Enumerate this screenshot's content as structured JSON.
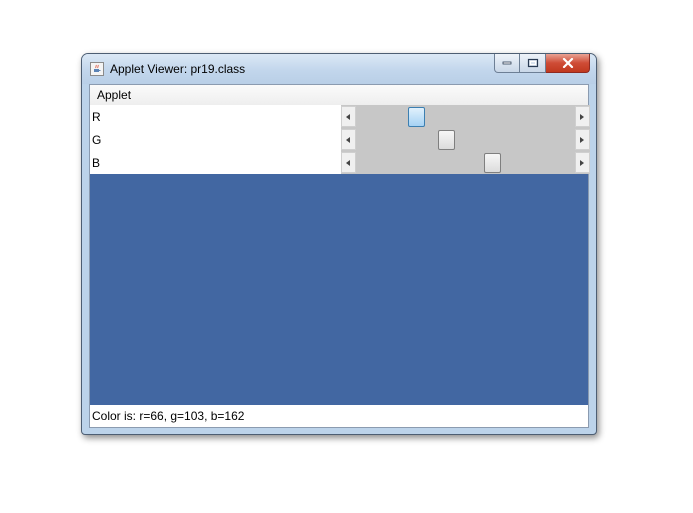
{
  "window": {
    "title": "Applet Viewer: pr19.class",
    "app_icon": "java-cup-icon",
    "controls": {
      "minimize": "minimize-icon",
      "maximize": "maximize-icon",
      "close": "close-icon"
    }
  },
  "menubar": {
    "items": [
      {
        "label": "Applet"
      }
    ]
  },
  "sliders": [
    {
      "label": "R",
      "value": 66,
      "min": 0,
      "max": 255,
      "focused": true
    },
    {
      "label": "G",
      "value": 103,
      "min": 0,
      "max": 255,
      "focused": false
    },
    {
      "label": "B",
      "value": 162,
      "min": 0,
      "max": 255,
      "focused": false
    }
  ],
  "colors": {
    "preview": "#4267a2",
    "titlebar": "#c2d6ec",
    "close_button": "#cf4c36",
    "scroll_track": "#c7c7c7"
  },
  "status": {
    "text": "Color is: r=66, g=103, b=162"
  }
}
